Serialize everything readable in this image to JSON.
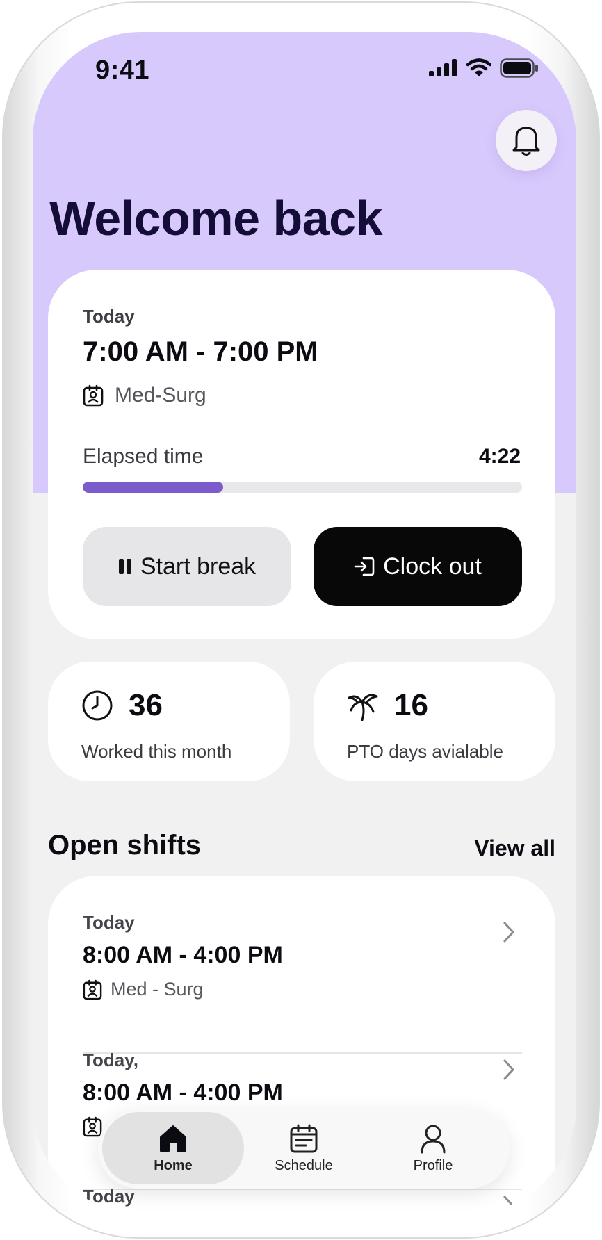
{
  "status_bar": {
    "time": "9:41"
  },
  "header": {
    "title": "Welcome back"
  },
  "current_shift": {
    "day_label": "Today",
    "time_range": "7:00 AM - 7:00 PM",
    "unit": "Med-Surg",
    "elapsed_label": "Elapsed time",
    "elapsed_value": "4:22",
    "progress_fraction": 0.32,
    "break_button": "Start break",
    "clock_out_button": "Clock out"
  },
  "stats": [
    {
      "value": "36",
      "label": "Worked this month",
      "icon": "clock-icon"
    },
    {
      "value": "16",
      "label": "PTO days avialable",
      "icon": "palm-tree-icon"
    }
  ],
  "open_shifts": {
    "title": "Open shifts",
    "view_all": "View all",
    "items": [
      {
        "day": "Today",
        "time": "8:00 AM - 4:00 PM",
        "unit": "Med - Surg"
      },
      {
        "day": "Today,",
        "time": "8:00 AM - 4:00 PM",
        "unit": ""
      },
      {
        "day": "Today",
        "time": "",
        "unit": ""
      }
    ]
  },
  "tabbar": {
    "items": [
      {
        "label": "Home",
        "icon": "home-icon",
        "active": true
      },
      {
        "label": "Schedule",
        "icon": "calendar-icon",
        "active": false
      },
      {
        "label": "Profile",
        "icon": "profile-icon",
        "active": false
      }
    ]
  },
  "colors": {
    "hero_bg": "#d8c9fc",
    "accent": "#7c5ccd",
    "title": "#140d38",
    "primary_button": "#080808"
  }
}
